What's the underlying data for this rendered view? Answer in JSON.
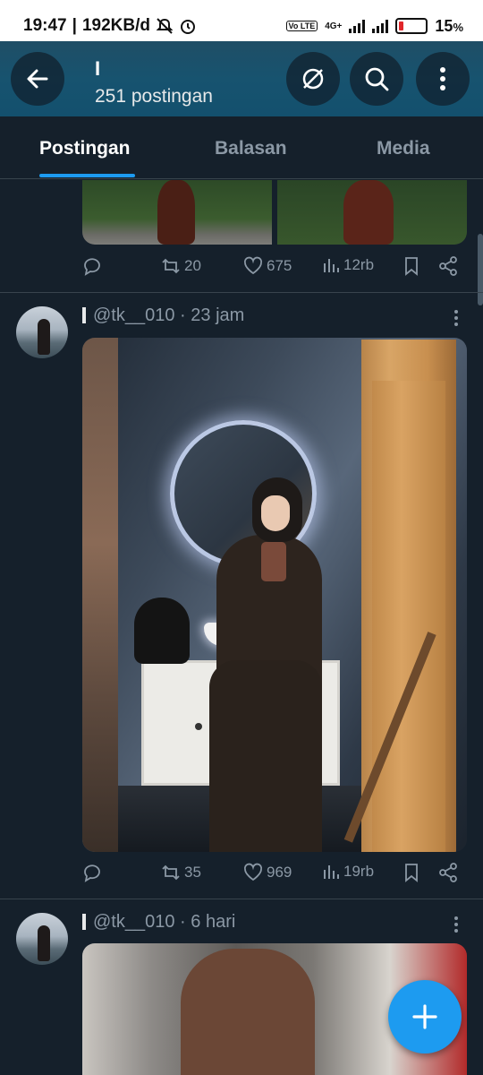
{
  "status_bar": {
    "time": "19:47",
    "network_speed": "192KB/d",
    "network_type": "4G+",
    "volte": "Vo LTE",
    "battery": "15",
    "battery_unit": "%"
  },
  "header": {
    "profile_name": "I",
    "post_count": "251 postingan",
    "icons": [
      "back-arrow-icon",
      "mute-icon",
      "search-icon",
      "more-vertical-icon"
    ]
  },
  "tabs": [
    {
      "label": "Postingan",
      "active": true
    },
    {
      "label": "Balasan",
      "active": false
    },
    {
      "label": "Media",
      "active": false
    }
  ],
  "posts": [
    {
      "stats": {
        "retweets": "20",
        "likes": "675",
        "views": "12rb"
      }
    },
    {
      "name": "I",
      "handle": "@tk__010",
      "time": "23 jam",
      "stats": {
        "retweets": "35",
        "likes": "969",
        "views": "19rb"
      }
    },
    {
      "name": "I",
      "handle": "@tk__010",
      "time": "6 hari"
    }
  ],
  "fab": {
    "icon": "plus-icon"
  },
  "colors": {
    "accent": "#1d9bf0",
    "background": "#15202b",
    "muted": "#8b98a5"
  }
}
